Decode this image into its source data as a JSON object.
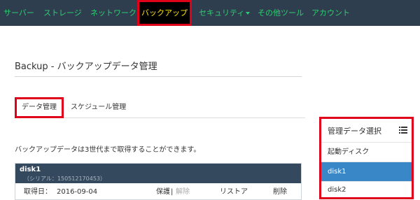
{
  "nav": {
    "items": [
      {
        "label": "サーバー"
      },
      {
        "label": "ストレージ"
      },
      {
        "label": "ネットワーク"
      },
      {
        "label": "バックアップ"
      },
      {
        "label": "セキュリティ"
      },
      {
        "label": "その他ツール"
      },
      {
        "label": "アカウント"
      }
    ],
    "active_index": 3
  },
  "page": {
    "title": "Backup - バックアップデータ管理"
  },
  "tabs": [
    {
      "label": "データ管理"
    },
    {
      "label": "スケジュール管理"
    }
  ],
  "info_text": "バックアップデータは3世代まで取得することができます。",
  "disk": {
    "name": "disk1",
    "serial": "（シリアル：150512170453）",
    "date_label": "取得日：",
    "date_value": "2016-09-04",
    "protect_label": "保護",
    "separator": "|",
    "unprotect_label": "解除",
    "restore_label": "リストア",
    "delete_label": "削除"
  },
  "side_panel": {
    "title": "管理データ選択",
    "icon": "list-icon",
    "items": [
      {
        "label": "起動ディスク"
      },
      {
        "label": "disk1"
      },
      {
        "label": "disk2"
      }
    ],
    "selected_index": 1
  },
  "colors": {
    "navbar_bg": "#2e3e4e",
    "nav_text": "#2ecc71",
    "active_nav_text": "#ffe600",
    "highlight_border": "#e0001a",
    "disk_header_bg": "#34495e",
    "selected_item_bg": "#3a87c8"
  }
}
